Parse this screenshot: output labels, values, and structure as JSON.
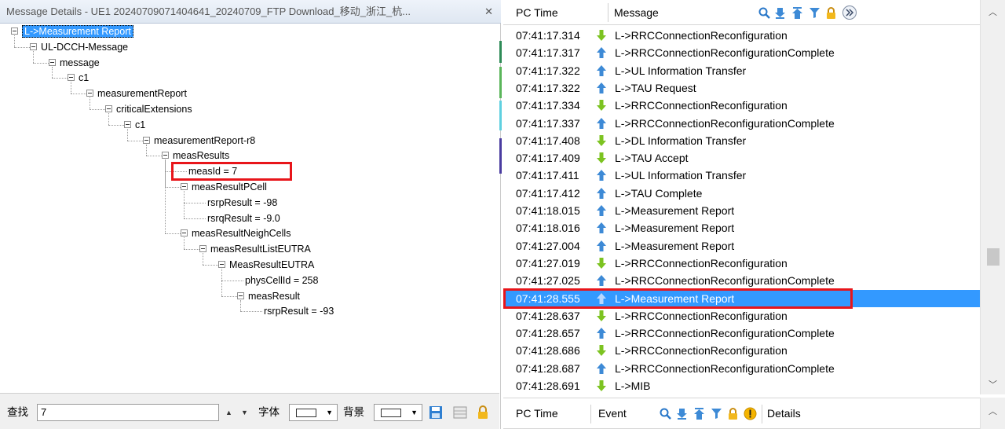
{
  "left_panel": {
    "title": "Message Details - UE1 20240709071404641_20240709_FTP Download_移动_浙江_杭...",
    "close": "✕",
    "tree": [
      {
        "label": "L->Measurement Report",
        "level": 0,
        "expanded": true,
        "selected": true
      },
      {
        "label": "UL-DCCH-Message",
        "level": 1,
        "expanded": true
      },
      {
        "label": "message",
        "level": 2,
        "expanded": true
      },
      {
        "label": "c1",
        "level": 3,
        "expanded": true
      },
      {
        "label": "measurementReport",
        "level": 4,
        "expanded": true
      },
      {
        "label": "criticalExtensions",
        "level": 5,
        "expanded": true
      },
      {
        "label": "c1",
        "level": 6,
        "expanded": true
      },
      {
        "label": "measurementReport-r8",
        "level": 7,
        "expanded": true
      },
      {
        "label": "measResults",
        "level": 8,
        "expanded": true
      },
      {
        "label": "measId = 7",
        "level": 9,
        "leaf": true,
        "highlighted": true
      },
      {
        "label": "measResultPCell",
        "level": 9,
        "expanded": true
      },
      {
        "label": "rsrpResult = -98",
        "level": 10,
        "leaf": true
      },
      {
        "label": "rsrqResult = -9.0",
        "level": 10,
        "leaf": true
      },
      {
        "label": "measResultNeighCells",
        "level": 9,
        "expanded": true
      },
      {
        "label": "measResultListEUTRA",
        "level": 10,
        "expanded": true
      },
      {
        "label": "MeasResultEUTRA",
        "level": 11,
        "expanded": true
      },
      {
        "label": "physCellId = 258",
        "level": 12,
        "leaf": true
      },
      {
        "label": "measResult",
        "level": 12,
        "expanded": true
      },
      {
        "label": "rsrpResult = -93",
        "level": 13,
        "leaf": true
      }
    ],
    "bottom": {
      "find_label": "查找",
      "find_value": "7",
      "font_label": "字体",
      "bg_label": "背景"
    }
  },
  "right_panel": {
    "header": {
      "col_time": "PC Time",
      "col_message": "Message"
    },
    "rows": [
      {
        "time": "07:41:17.314",
        "dir": "down",
        "msg": "L->RRCConnectionReconfiguration"
      },
      {
        "time": "07:41:17.317",
        "dir": "up",
        "msg": "L->RRCConnectionReconfigurationComplete"
      },
      {
        "time": "07:41:17.322",
        "dir": "up",
        "msg": "L->UL Information Transfer"
      },
      {
        "time": "07:41:17.322",
        "dir": "up",
        "msg": "L->TAU Request"
      },
      {
        "time": "07:41:17.334",
        "dir": "down",
        "msg": "L->RRCConnectionReconfiguration"
      },
      {
        "time": "07:41:17.337",
        "dir": "up",
        "msg": "L->RRCConnectionReconfigurationComplete"
      },
      {
        "time": "07:41:17.408",
        "dir": "down",
        "msg": "L->DL Information Transfer"
      },
      {
        "time": "07:41:17.409",
        "dir": "down",
        "msg": "L->TAU Accept"
      },
      {
        "time": "07:41:17.411",
        "dir": "up",
        "msg": "L->UL Information Transfer"
      },
      {
        "time": "07:41:17.412",
        "dir": "up",
        "msg": "L->TAU Complete"
      },
      {
        "time": "07:41:18.015",
        "dir": "up",
        "msg": "L->Measurement Report"
      },
      {
        "time": "07:41:18.016",
        "dir": "up",
        "msg": "L->Measurement Report"
      },
      {
        "time": "07:41:27.004",
        "dir": "up",
        "msg": "L->Measurement Report"
      },
      {
        "time": "07:41:27.019",
        "dir": "down",
        "msg": "L->RRCConnectionReconfiguration"
      },
      {
        "time": "07:41:27.025",
        "dir": "up",
        "msg": "L->RRCConnectionReconfigurationComplete"
      },
      {
        "time": "07:41:28.555",
        "dir": "up",
        "msg": "L->Measurement Report",
        "selected": true,
        "highlighted": true
      },
      {
        "time": "07:41:28.637",
        "dir": "down",
        "msg": "L->RRCConnectionReconfiguration"
      },
      {
        "time": "07:41:28.657",
        "dir": "up",
        "msg": "L->RRCConnectionReconfigurationComplete"
      },
      {
        "time": "07:41:28.686",
        "dir": "down",
        "msg": "L->RRCConnectionReconfiguration"
      },
      {
        "time": "07:41:28.687",
        "dir": "up",
        "msg": "L->RRCConnectionReconfigurationComplete"
      },
      {
        "time": "07:41:28.691",
        "dir": "down",
        "msg": "L->MIB"
      }
    ],
    "lower_header": {
      "col_time": "PC Time",
      "col_event": "Event",
      "col_details": "Details"
    }
  },
  "colors": {
    "selection": "#3399ff",
    "highlight_box": "#e8151a",
    "down_arrow": "#7cc321",
    "up_arrow": "#3d8ad6"
  }
}
